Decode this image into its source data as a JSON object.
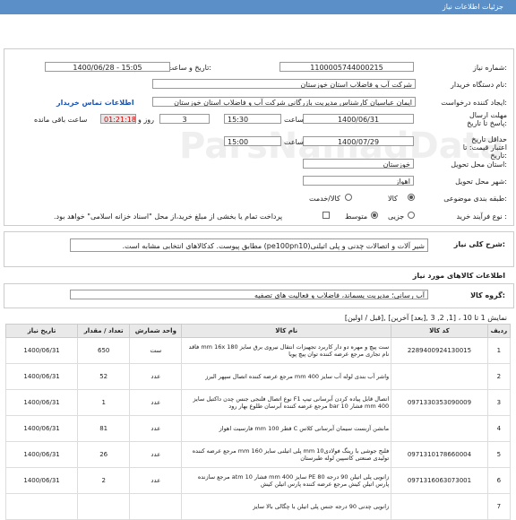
{
  "page_title": "جزئیات اطلاعات نیاز",
  "fields": {
    "need_number_label": "شماره نیاز:",
    "need_number": "1100005744000215",
    "announce_label": "تاریخ و ساعت اعلان عمومی:",
    "announce_value": "1400/06/28 - 15:05",
    "buyer_org_label": "نام دستگاه خریدار:",
    "buyer_org": "شرکت آب و فاضلاب استان خوزستان",
    "creator_label": "ایجاد کننده درخواست:",
    "creator": "ایمان عباسیان کارشناس مدیریت بازرگانی شرکت آب و فاضلاب استان خوزستان",
    "contact_link": "اطلاعات تماس خریدار",
    "deadline_label": "مهلت ارسال پاسخ تا تاریخ:",
    "deadline_date": "1400/06/31",
    "time_label": "ساعت",
    "deadline_time": "15:30",
    "days": "3",
    "days_label": "روز و",
    "remaining": "01:21:18",
    "remaining_label": "ساعت باقی مانده",
    "min_valid_label": "حداقل تاریخ اعتبار قیمت: تا تاریخ:",
    "min_valid_date": "1400/07/29",
    "min_valid_time_label": "ساعت",
    "min_valid_time": "15:00",
    "province_label": "استان محل تحویل:",
    "province": "خوزستان",
    "city_label": "شهر محل تحویل:",
    "city": "اهواز",
    "category_label": "طبقه بندی موضوعی:",
    "category_opt1": "کالا",
    "category_opt2": "کالا/خدمت",
    "purchase_label": "نوع فرآیند خرید :",
    "purchase_opt1": "جزیی",
    "purchase_opt2": "متوسط",
    "payment_note": "پرداخت تمام یا بخشی از مبلغ خرید،از محل \"اسناد خزانه اسلامی\" خواهد بود."
  },
  "summary": {
    "label": "شرح کلی نیاز:",
    "text": "شیر آلات و اتصالات چدنی و پلی اتیلنی(pe100pn10) مطابق پیوست. کدکالاهای انتخابی مشابه است."
  },
  "goods_info_title": "اطلاعات کالاهای مورد نیاز",
  "group": {
    "label": "گروه کالا:",
    "value": "آب رسانی؛ مدیریت پسماند، فاضلاب و فعالیت های تصفیه"
  },
  "pagination": "نمایش 1 تا 10 ، [1, 2, 3 ,[بعد] آخرین] ,[قبل / اولین]",
  "table": {
    "headers": [
      "ردیف",
      "کد کالا",
      "نام کالا",
      "واحد شمارش",
      "تعداد / مقدار",
      "تاریخ نیاز"
    ],
    "rows": [
      {
        "row": "1",
        "code": "2289400924130015",
        "name": "ست پیچ و مهره دو دار کاربرد تجهیزات انتقال نیروی برق سایز 180 mm 16x فاقد نام تجاری مرجع عرضه کننده توان پیچ پویا",
        "unit": "ست",
        "qty": "650",
        "date": "1400/06/31"
      },
      {
        "row": "2",
        "code": "",
        "name": "واشر آب بندی لوله آب سایز 400 mm مرجع عرضه کننده اتصال سپهر البرز",
        "unit": "عدد",
        "qty": "52",
        "date": "1400/06/31"
      },
      {
        "row": "3",
        "code": "0971330353090009",
        "name": "اتصال قابل پیاده کردن آبرسانی تیپ F1 نوع اتصال فلنجی جنس چدن داکتیل سایز 400 mm فشار 10 bar مرجع عرضه کننده آبرسان طلوع بهار رود",
        "unit": "عدد",
        "qty": "1",
        "date": "1400/06/31"
      },
      {
        "row": "4",
        "code": "",
        "name": "مانشن آزبست سیمان آبرسانی کلاس C قطر 100 mm فارسیت اهواز",
        "unit": "عدد",
        "qty": "81",
        "date": "1400/06/31"
      },
      {
        "row": "5",
        "code": "0971310178660004",
        "name": "فلنج جوشی با رینگ فولادی10 mm پلی اتیلنی سایز 160 mm مرجع عرضه کننده تولیدی صنعتی کاسپین لوله طبرستان",
        "unit": "عدد",
        "qty": "26",
        "date": "1400/06/31"
      },
      {
        "row": "6",
        "code": "0971316063073001",
        "name": "زانویی پلی اتیلن 90 درجه PE 80 سایز 400 mm فشار 10 atm مرجع سازنده پارس اتیلن کیش مرجع عرضه کننده پارس اتیلن کیش",
        "unit": "عدد",
        "qty": "2",
        "date": "1400/06/31"
      },
      {
        "row": "7",
        "code": "",
        "name": "زانویی چدنی 90 درجه جنس پلی اتیلن با چگالی بالا سایز",
        "unit": "",
        "qty": "",
        "date": ""
      }
    ]
  }
}
